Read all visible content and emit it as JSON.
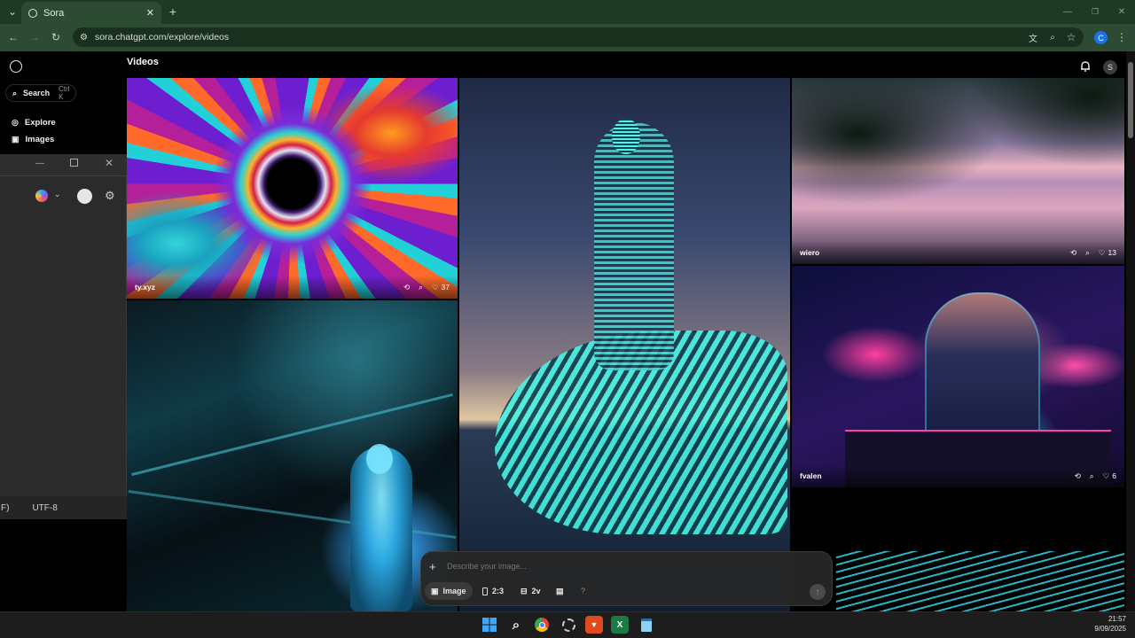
{
  "browser": {
    "tab_title": "Sora",
    "url": "sora.chatgpt.com/explore/videos"
  },
  "sidebar": {
    "search_label": "Search",
    "search_shortcut": "Ctrl K",
    "items": [
      {
        "label": "Explore",
        "icon": "compass-icon"
      },
      {
        "label": "Images",
        "icon": "image-icon"
      }
    ]
  },
  "overlay_window": {
    "encoding": "UTF-8",
    "status_prefix": "F)"
  },
  "header": {
    "title": "Videos",
    "avatar_initial": "S"
  },
  "tiles": [
    {
      "author": "ty.xyz",
      "likes": "37"
    },
    {
      "author": "",
      "likes": ""
    },
    {
      "author": "",
      "likes": ""
    },
    {
      "author": "wiero",
      "likes": "13"
    },
    {
      "author": "fvalen",
      "likes": "6"
    },
    {
      "author": "",
      "likes": ""
    }
  ],
  "composer": {
    "placeholder": "Describe your image...",
    "type_label": "Image",
    "aspect_label": "2:3",
    "variations_label": "2v",
    "help_label": "?"
  },
  "taskbar": {
    "time": "21:57",
    "date": "9/09/2025",
    "excel_letter": "X"
  },
  "colors": {
    "chrome_bg": "#2d4a33",
    "tab_bar": "#1f3a24",
    "page_bg": "#000000"
  }
}
